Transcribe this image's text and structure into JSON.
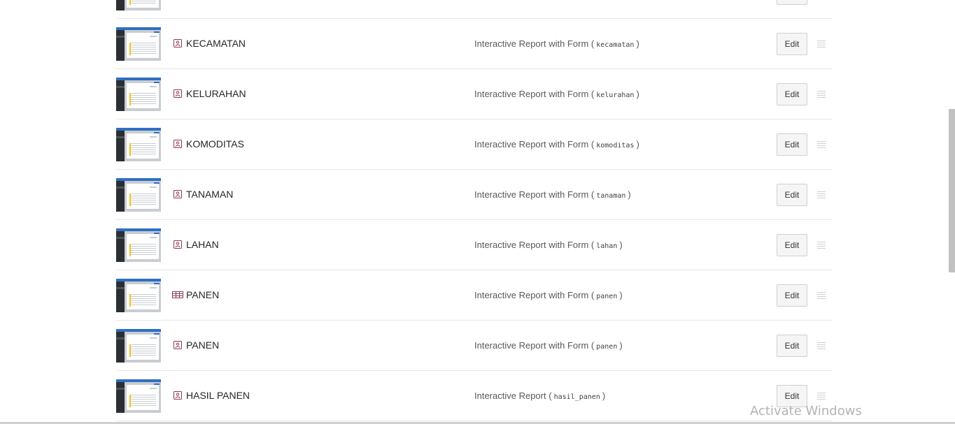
{
  "rows": [
    {
      "name": "",
      "description": "",
      "code": "",
      "type_icon": "form-icon"
    },
    {
      "name": "KECAMATAN",
      "description": "Interactive Report with Form",
      "code": "kecamatan",
      "type_icon": "form-icon"
    },
    {
      "name": "KELURAHAN",
      "description": "Interactive Report with Form",
      "code": "kelurahan",
      "type_icon": "form-icon"
    },
    {
      "name": "KOMODITAS",
      "description": "Interactive Report with Form",
      "code": "komoditas",
      "type_icon": "form-icon"
    },
    {
      "name": "TANAMAN",
      "description": "Interactive Report with Form",
      "code": "tanaman",
      "type_icon": "form-icon"
    },
    {
      "name": "LAHAN",
      "description": "Interactive Report with Form",
      "code": "lahan",
      "type_icon": "form-icon"
    },
    {
      "name": "PANEN",
      "description": "Interactive Report with Form",
      "code": "panen",
      "type_icon": "table-icon"
    },
    {
      "name": "PANEN",
      "description": "Interactive Report with Form",
      "code": "panen",
      "type_icon": "form-icon"
    },
    {
      "name": "HASIL PANEN",
      "description": "Interactive Report",
      "code": "hasil_panen",
      "type_icon": "form-icon"
    }
  ],
  "edit_label": "Edit",
  "paren_open": "(",
  "paren_close": ")",
  "watermark": "Activate Windows",
  "colors": {
    "thumbnail_header": "#2f6fc4",
    "thumbnail_sidebar": "#2b2f33",
    "thumbnail_accent": "#f0c419",
    "type_icon": "#8a3a52"
  }
}
